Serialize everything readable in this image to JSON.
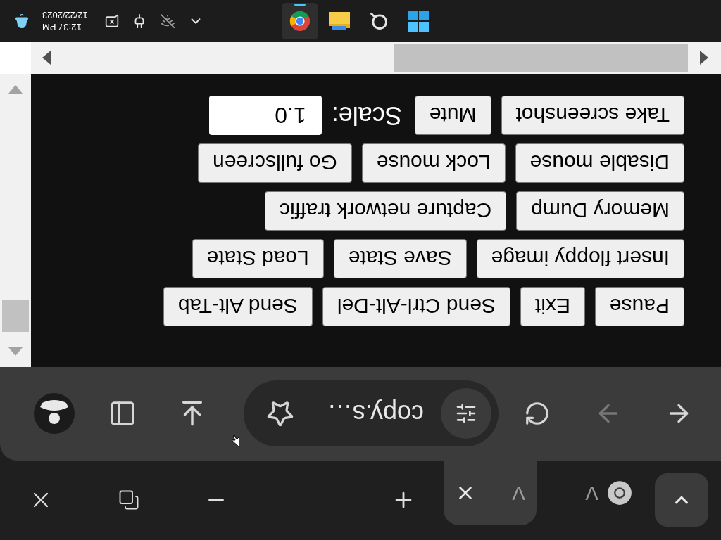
{
  "tab_strip": {
    "tabs": [
      {
        "title": "V",
        "selected": false
      },
      {
        "title": "V",
        "selected": true
      }
    ]
  },
  "toolbar": {
    "back": {
      "disabled": false
    },
    "forward": {
      "disabled": true
    },
    "url": "copy.s…"
  },
  "page": {
    "button_rows": [
      [
        "Pause",
        "Exit",
        "Send Ctrl-Alt-Del",
        "Send Alt-Tab"
      ],
      [
        "Insert floppy image",
        "Save State",
        "Load State"
      ],
      [
        "Memory Dump",
        "Capture network traffic"
      ],
      [
        "Disable mouse",
        "Lock mouse",
        "Go fullscreen"
      ],
      [
        "Take screenshot",
        "Mute"
      ]
    ],
    "scale": {
      "label": "Scale:",
      "value": "1.0"
    }
  },
  "taskbar": {
    "apps": [
      {
        "kind": "start",
        "selected": false
      },
      {
        "kind": "search",
        "selected": false
      },
      {
        "kind": "files",
        "selected": false
      },
      {
        "kind": "browser",
        "selected": true
      }
    ],
    "time": "12:37 PM",
    "date": "12/22/2023"
  }
}
